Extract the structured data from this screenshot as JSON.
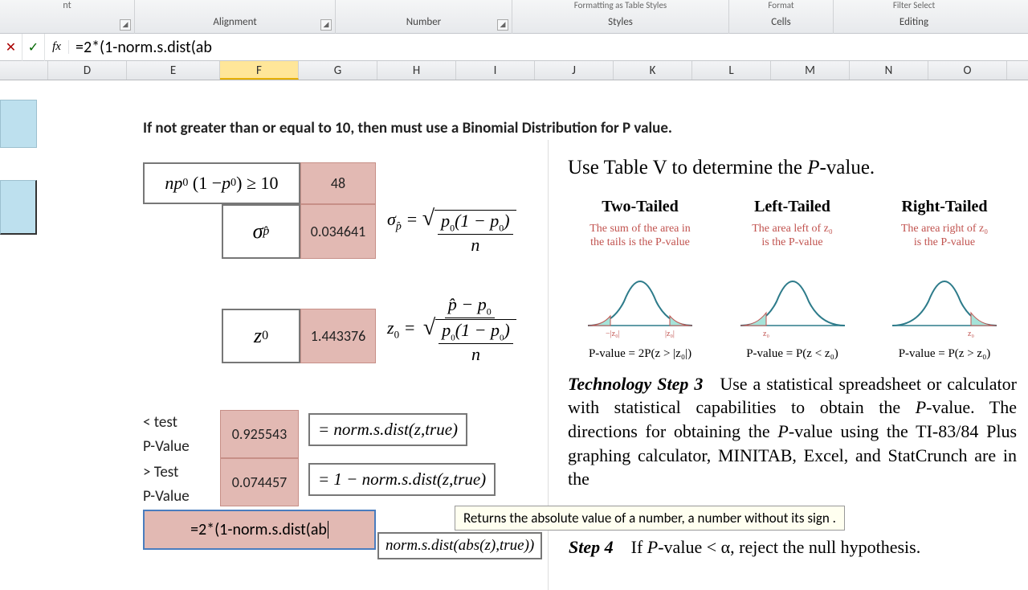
{
  "ribbon": {
    "groups": [
      {
        "label": "",
        "launcher": true,
        "hint": "nt"
      },
      {
        "label": "Alignment",
        "launcher": true,
        "hint": ""
      },
      {
        "label": "Number",
        "launcher": true,
        "hint": ""
      },
      {
        "label": "Styles",
        "launcher": false,
        "hint": "Formatting   as Table   Styles"
      },
      {
        "label": "Cells",
        "launcher": false,
        "hint": "Format"
      },
      {
        "label": "Editing",
        "launcher": false,
        "hint": "Filter   Select"
      }
    ]
  },
  "formula_bar": {
    "cancel": "✕",
    "enter": "✓",
    "fx": "fx",
    "content": "=2*(1-norm.s.dist(ab"
  },
  "columns": [
    "D",
    "E",
    "F",
    "G",
    "H",
    "I",
    "J",
    "K",
    "L",
    "M",
    "N",
    "O"
  ],
  "active_column": "F",
  "sheet": {
    "header_text": "If not greater than or equal to 10, then must use a Binomial Distribution for P value.",
    "np_condition": "np₀ (1 − p₀) ≥ 10",
    "np_value": "48",
    "sigma_label": "σp̂",
    "sigma_value": "0.034641",
    "z_label": "z₀",
    "z_value": "1.443376",
    "lt_label1": "< test",
    "lt_label2": "P-Value",
    "lt_value": "0.925543",
    "gt_label1": "> Test",
    "gt_label2": "P-Value",
    "gt_value": "0.074457",
    "editing_formula": "=2*(1-norm.s.dist(ab",
    "formula_lt": "= norm.s.dist(z,true)",
    "formula_gt": "= 1 − norm.s.dist(z,true)",
    "formula_two": "norm.s.dist(abs(z),true))"
  },
  "book": {
    "title": "Use Table V to determine the P-value.",
    "tails": [
      {
        "hd": "Two-Tailed",
        "sub1": "The sum of the area in",
        "sub2": "the tails is the P-value",
        "pv": "P-value = 2P(z > |z₀|)",
        "left_tick": "−|z₀|",
        "right_tick": "|z₀|",
        "shade": "both"
      },
      {
        "hd": "Left-Tailed",
        "sub1": "The area left of z₀",
        "sub2": "is the P-value",
        "pv": "P-value = P(z < z₀)",
        "left_tick": "z₀",
        "right_tick": "",
        "shade": "left"
      },
      {
        "hd": "Right-Tailed",
        "sub1": "The area right of z₀",
        "sub2": "is the P-value",
        "pv": "P-value = P(z > z₀)",
        "left_tick": "",
        "right_tick": "z₀",
        "shade": "right"
      }
    ],
    "tech_para": "Technology Step 3   Use a statistical spreadsheet or calculator with statistical capabilities to obtain the P-value. The directions for obtaining the P-value using the TI-83/84 Plus graphing calculator, MINITAB, Excel, and StatCrunch are in the",
    "tooltip": "Returns the absolute value of a number, a number without its sign",
    "step4": "Step 4    If P-value < α, reject the null hypothesis."
  },
  "chart_data": [
    {
      "type": "area",
      "title": "Two-Tailed",
      "x": [
        -3,
        -1.5,
        0,
        1.5,
        3
      ],
      "shade": "both_tails",
      "tick_labels": [
        "-|z0|",
        "|z0|"
      ]
    },
    {
      "type": "area",
      "title": "Left-Tailed",
      "x": [
        -3,
        -1.5,
        0,
        3
      ],
      "shade": "left_tail",
      "tick_labels": [
        "z0"
      ]
    },
    {
      "type": "area",
      "title": "Right-Tailed",
      "x": [
        -3,
        0,
        1.5,
        3
      ],
      "shade": "right_tail",
      "tick_labels": [
        "z0"
      ]
    }
  ]
}
